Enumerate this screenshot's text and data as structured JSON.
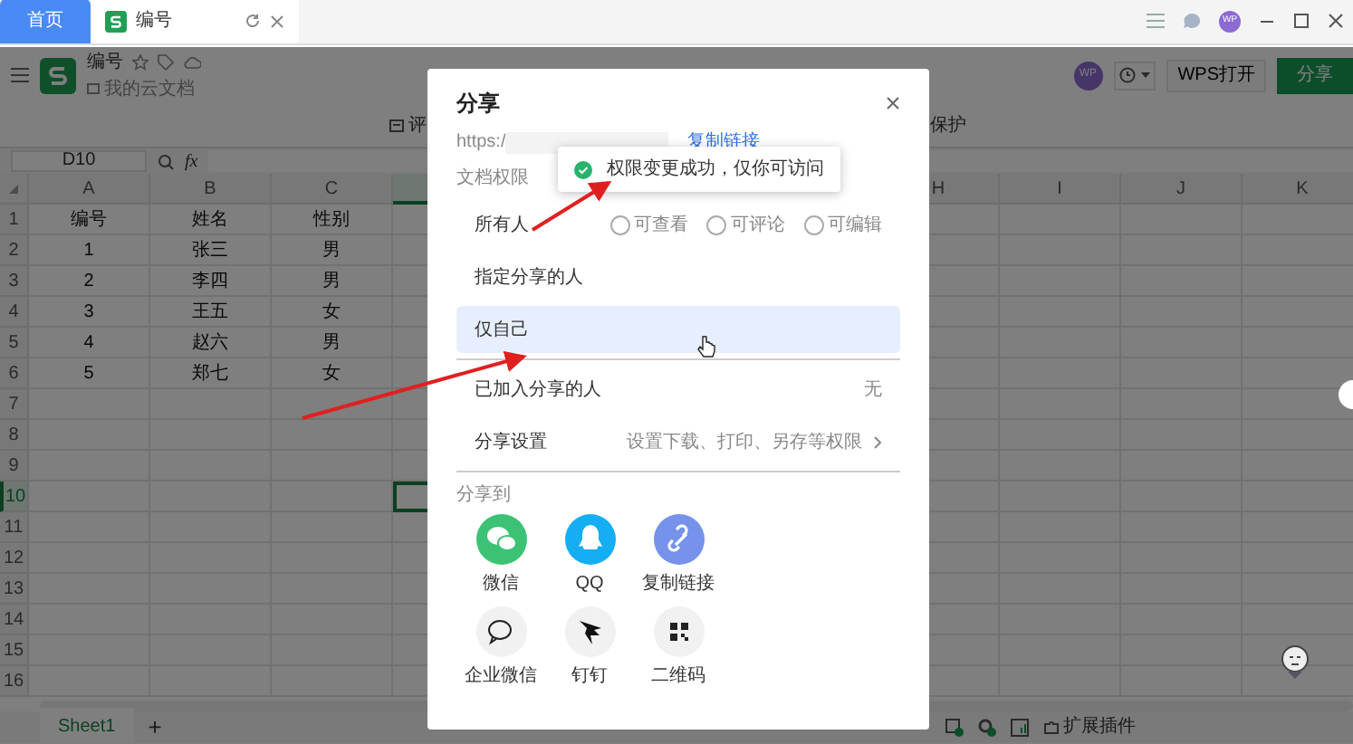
{
  "browser_tabs": [
    {
      "label": "首页",
      "kind": "home",
      "selected": false
    },
    {
      "label": "编号",
      "kind": "doc",
      "selected": true
    }
  ],
  "titlebar": {
    "avatar": "WP"
  },
  "document": {
    "title": "编号",
    "location": "我的云文档",
    "avatar": "WP",
    "open_button": "WPS打开",
    "share_button": "分享"
  },
  "toolbar": [
    "评",
    "保护"
  ],
  "formula_bar": {
    "name_box": "D10",
    "fx": "fx"
  },
  "sheet": {
    "columns_left": [
      {
        "label": "A",
        "selected": false
      },
      {
        "label": "B",
        "selected": false
      },
      {
        "label": "C",
        "selected": false
      },
      {
        "selected": true
      }
    ],
    "columns_right": [
      {
        "label": "H",
        "selected": false
      },
      {
        "label": "I",
        "selected": false
      },
      {
        "label": "J",
        "selected": false
      },
      {
        "label": "K",
        "selected": false
      }
    ],
    "row_headers": [
      {
        "label": "1",
        "selected": false
      },
      {
        "label": "2",
        "selected": false
      },
      {
        "label": "3",
        "selected": false
      },
      {
        "label": "4",
        "selected": false
      },
      {
        "label": "5",
        "selected": false
      },
      {
        "label": "6",
        "selected": false
      },
      {
        "label": "7",
        "selected": false
      },
      {
        "label": "8",
        "selected": false
      },
      {
        "label": "9",
        "selected": false
      },
      {
        "label": "10",
        "selected": true
      },
      {
        "label": "11",
        "selected": false
      },
      {
        "label": "12",
        "selected": false
      },
      {
        "label": "13",
        "selected": false
      },
      {
        "label": "14",
        "selected": false
      },
      {
        "label": "15",
        "selected": false
      },
      {
        "label": "16",
        "selected": false
      }
    ],
    "rows": [
      [
        "编号",
        "姓名",
        "性别"
      ],
      [
        "1",
        "张三",
        "男"
      ],
      [
        "2",
        "李四",
        "男"
      ],
      [
        "3",
        "王五",
        "女"
      ],
      [
        "4",
        "赵六",
        "男"
      ],
      [
        "5",
        "郑七",
        "女"
      ]
    ]
  },
  "sheet_tabs": [
    {
      "label": "Sheet1",
      "selected": true
    }
  ],
  "add_sheet": "+",
  "status_bar": {
    "plugins": "扩展插件"
  },
  "share_dialog": {
    "title": "分享",
    "link_prefix": "https:/",
    "copy_link": "复制链接",
    "permission_label": "文档权限",
    "permission_options": [
      {
        "label": "所有人",
        "selected": false,
        "sub_options": [
          {
            "label": "可查看",
            "checked": false
          },
          {
            "label": "可评论",
            "checked": false
          },
          {
            "label": "可编辑",
            "checked": false
          }
        ]
      },
      {
        "label": "指定分享的人",
        "selected": false
      },
      {
        "label": "仅自己",
        "selected": true
      }
    ],
    "joined": {
      "label": "已加入分享的人",
      "value": "无"
    },
    "settings": {
      "label": "分享设置",
      "value": "设置下载、打印、另存等权限"
    },
    "share_to_label": "分享到",
    "targets": [
      {
        "label": "微信",
        "kind": "wechat"
      },
      {
        "label": "QQ",
        "kind": "qq"
      },
      {
        "label": "复制链接",
        "kind": "link"
      },
      {
        "label": "企业微信",
        "kind": "wecom"
      },
      {
        "label": "钉钉",
        "kind": "dingtalk"
      },
      {
        "label": "二维码",
        "kind": "qrcode"
      }
    ]
  },
  "toast": {
    "message": "权限变更成功，仅你可访问"
  }
}
